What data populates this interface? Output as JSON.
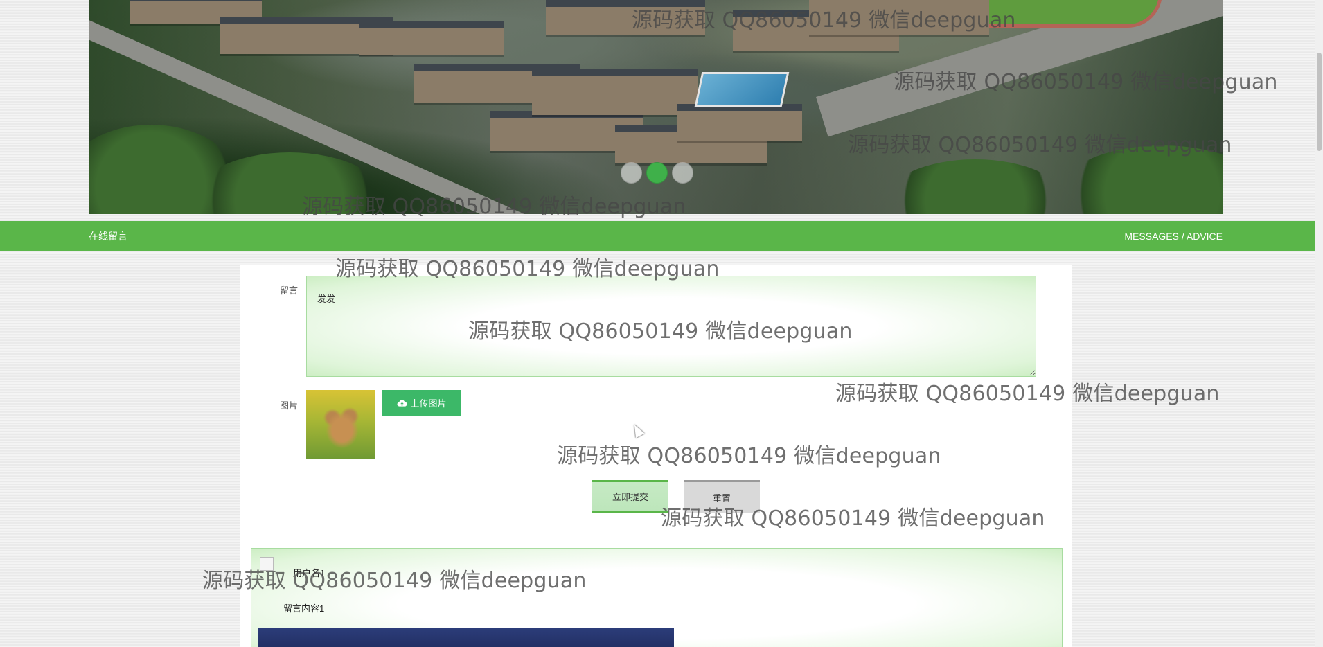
{
  "banner": {
    "slides": 3,
    "active_slide": 2
  },
  "section": {
    "title": "在线留言",
    "subtitle": "MESSAGES / ADVICE"
  },
  "form": {
    "message_label": "留言",
    "message_value": "发发",
    "image_label": "图片",
    "upload_button": "上传图片",
    "submit_button": "立即提交",
    "reset_button": "重置"
  },
  "messages": [
    {
      "username": "用户名1",
      "content": "留言内容1"
    }
  ],
  "watermark": {
    "text": "源码获取 QQ86050149 微信deepguan"
  },
  "colors": {
    "accent": "#5ab649",
    "upload_button": "#3cb868",
    "dot_active": "#3fb04a"
  },
  "icons": {
    "upload": "cloud-upload-icon"
  }
}
